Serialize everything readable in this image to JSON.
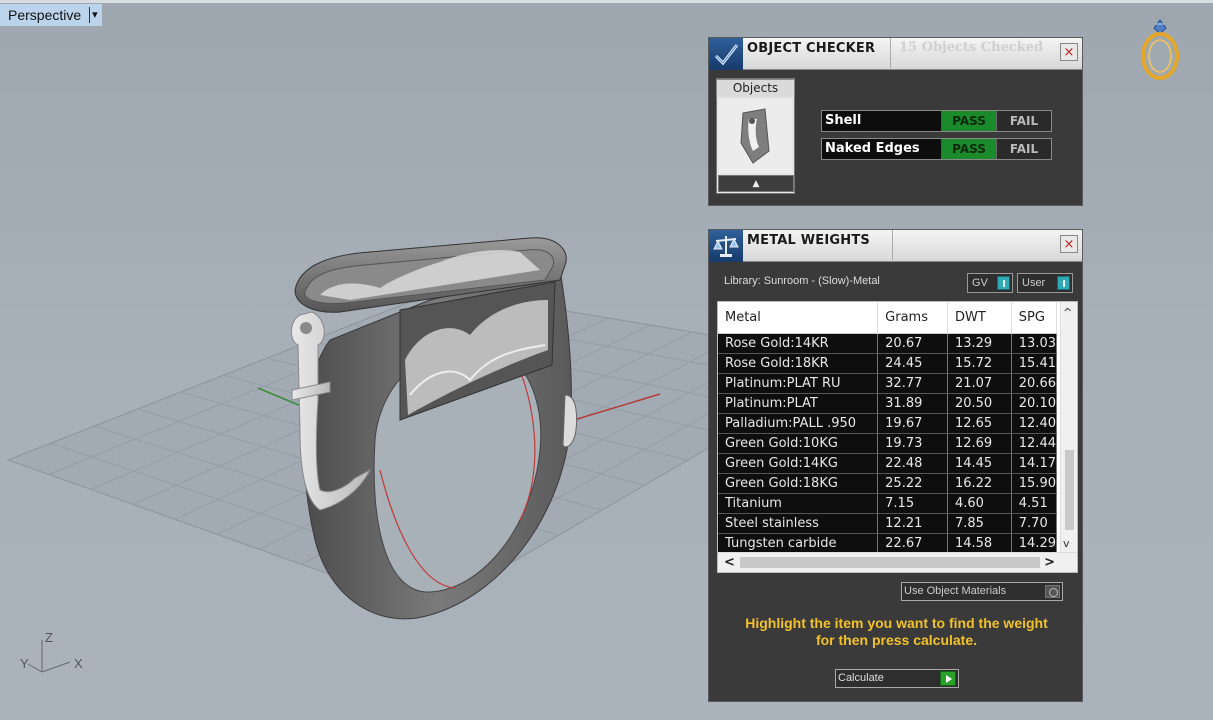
{
  "viewport": {
    "label": "Perspective",
    "menu_glyph": "▾",
    "axes": {
      "z": "Z",
      "x": "X",
      "y": "Y"
    }
  },
  "object_checker": {
    "title": "OBJECT CHECKER",
    "checked_count": "15 Objects Checked",
    "objects_tab": "Objects",
    "up_glyph": "▲",
    "checks": [
      {
        "name": "Shell",
        "pass": "PASS",
        "fail": "FAIL",
        "status": "pass"
      },
      {
        "name": "Naked Edges",
        "pass": "PASS",
        "fail": "FAIL",
        "status": "pass"
      }
    ]
  },
  "metal_weights": {
    "title": "METAL WEIGHTS",
    "library": "Library: Sunroom - (Slow)-Metal",
    "toggle_gv": "GV",
    "toggle_user": "User",
    "columns": [
      "Metal",
      "Grams",
      "DWT",
      "SPG"
    ],
    "rows": [
      [
        "Rose Gold:14KR",
        "20.67",
        "13.29",
        "13.03"
      ],
      [
        "Rose Gold:18KR",
        "24.45",
        "15.72",
        "15.41"
      ],
      [
        "Platinum:PLAT RU",
        "32.77",
        "21.07",
        "20.66"
      ],
      [
        "Platinum:PLAT",
        "31.89",
        "20.50",
        "20.10"
      ],
      [
        "Palladium:PALL .950",
        "19.67",
        "12.65",
        "12.40"
      ],
      [
        "Green Gold:10KG",
        "19.73",
        "12.69",
        "12.44"
      ],
      [
        "Green Gold:14KG",
        "22.48",
        "14.45",
        "14.17"
      ],
      [
        "Green Gold:18KG",
        "25.22",
        "16.22",
        "15.90"
      ],
      [
        "Titanium",
        "7.15",
        "4.60",
        "4.51"
      ],
      [
        "Steel stainless",
        "12.21",
        "7.85",
        "7.70"
      ],
      [
        "Tungsten carbide",
        "22.67",
        "14.58",
        "14.29"
      ]
    ],
    "use_object_materials": "Use Object Materials",
    "hint_line1": "Highlight the item you want to find the weight",
    "hint_line2": "for then press calculate.",
    "calculate": "Calculate",
    "scroll": {
      "up": "^",
      "down": "v",
      "left": "<",
      "right": ">"
    }
  },
  "icons": {
    "close": "×",
    "logo": "ring-logo-icon"
  },
  "colors": {
    "pass_green": "#1a8a2a",
    "hint_yellow": "#f2c12e",
    "toggle_teal": "#2fa9b5",
    "viewport_bg": "#a5adb6"
  }
}
